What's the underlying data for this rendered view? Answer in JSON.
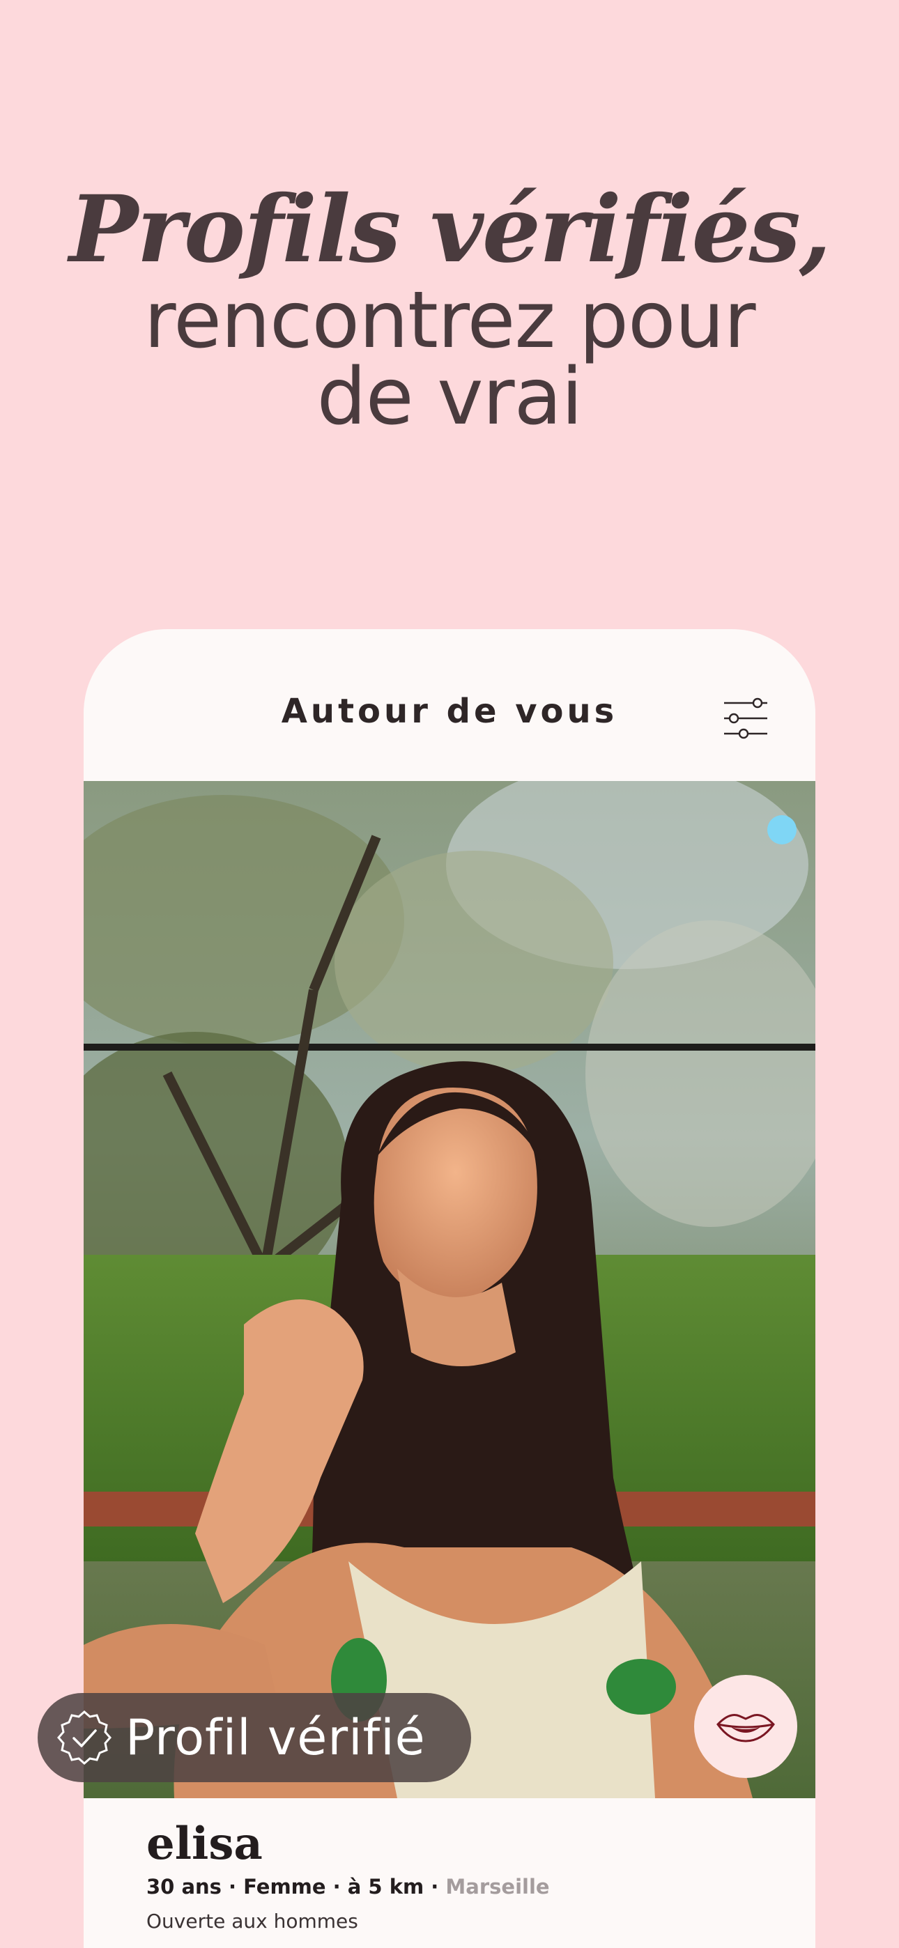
{
  "headline": {
    "line1": "Profils vérifiés,",
    "line2": "rencontrez pour",
    "line3": "de vrai"
  },
  "card": {
    "title": "Autour de vous",
    "filter_icon": "sliders-icon"
  },
  "profile": {
    "name": "elisa",
    "details": "30 ans · Femme · à 5 km · ",
    "city": "Marseille",
    "orientation": "Ouverte aux hommes",
    "photo_alt": "profile-photo"
  },
  "badge": {
    "label": "Profil vérifié",
    "icon": "verified-check-icon"
  },
  "actions": {
    "kiss_icon": "lips-icon"
  },
  "colors": {
    "background": "#fdd9dc",
    "card": "#fdf9f8",
    "headline": "#4a3b3e",
    "accent_dot": "#7fd6f5",
    "lips": "#7a1622"
  }
}
